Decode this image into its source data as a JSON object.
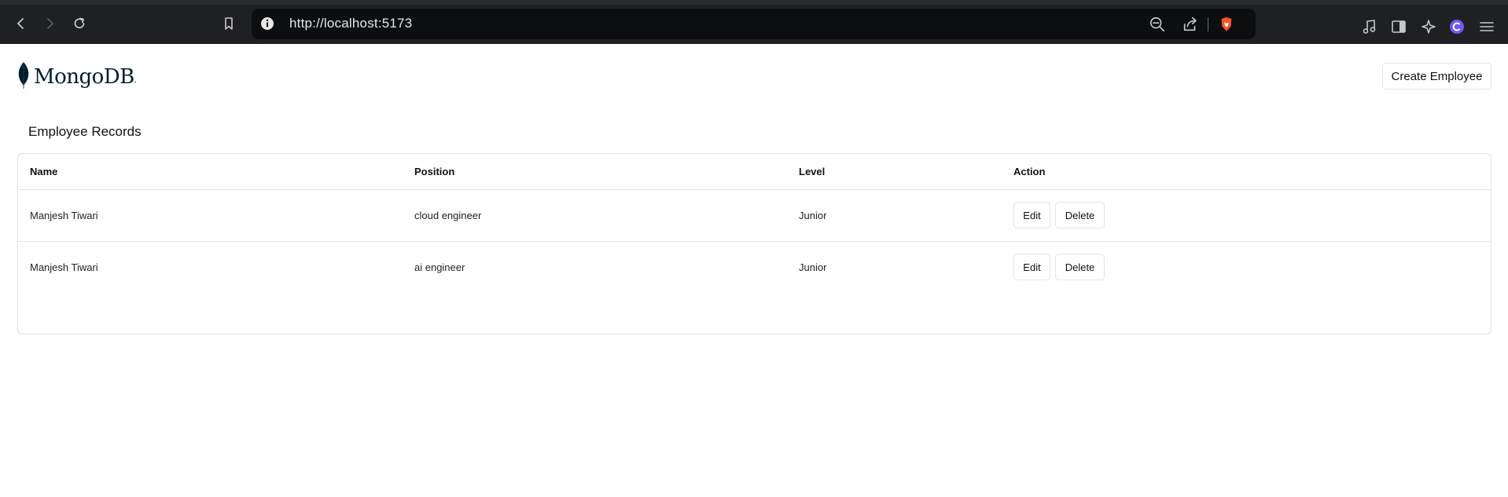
{
  "browser": {
    "url": "http://localhost:5173",
    "nav_icons": [
      "back-icon",
      "forward-icon",
      "reload-icon",
      "bookmark-icon"
    ],
    "toolbar_icons": [
      "zoom-out-icon",
      "share-icon",
      "brave-shield-icon",
      "media-icon",
      "sidebar-icon",
      "leo-ai-icon",
      "wallet-icon",
      "menu-icon"
    ],
    "brave_color": "#fb542b"
  },
  "header": {
    "logo_text": "MongoDB",
    "logo_color": "#00684a",
    "create_button_label": "Create Employee"
  },
  "main": {
    "title": "Employee Records",
    "columns": [
      "Name",
      "Position",
      "Level",
      "Action"
    ],
    "rows": [
      {
        "name": "Manjesh Tiwari",
        "position": "cloud engineer",
        "level": "Junior",
        "edit_label": "Edit",
        "delete_label": "Delete"
      },
      {
        "name": "Manjesh Tiwari",
        "position": "ai engineer",
        "level": "Junior",
        "edit_label": "Edit",
        "delete_label": "Delete"
      }
    ]
  }
}
